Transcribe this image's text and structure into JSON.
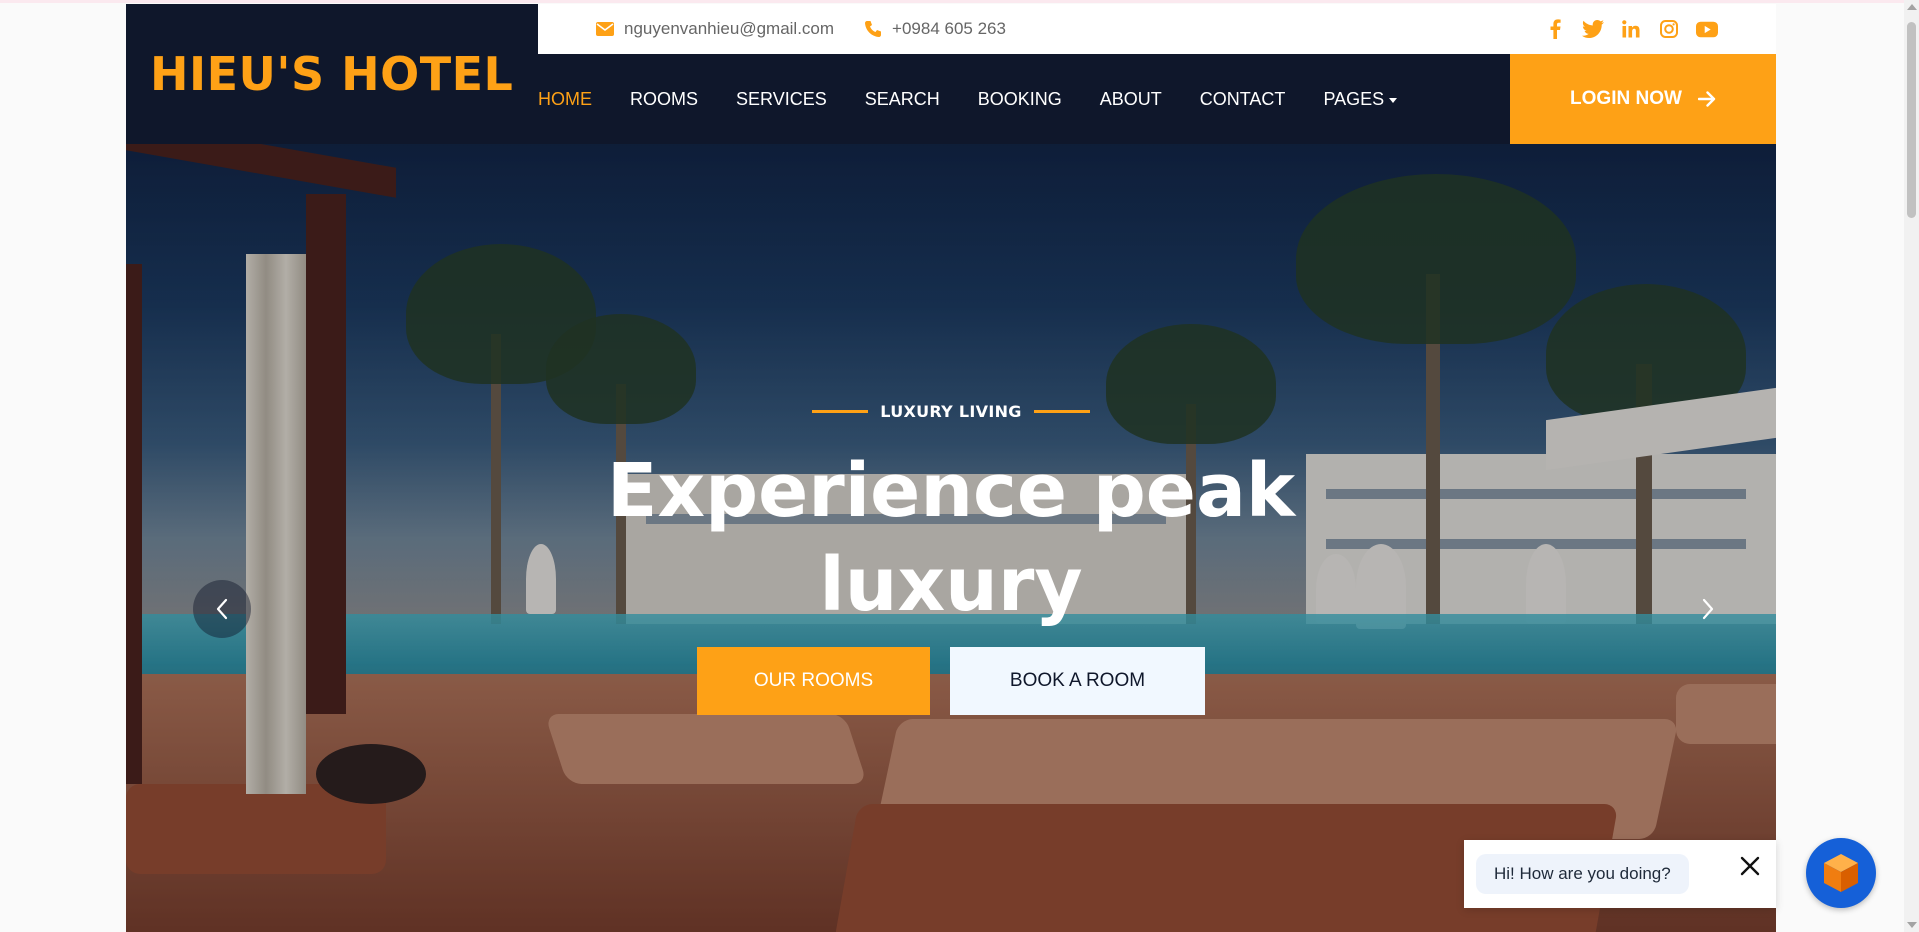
{
  "brand": {
    "name": "HIEU'S HOTEL"
  },
  "contact": {
    "email": "nguyenvanhieu@gmail.com",
    "phone": "+0984 605 263",
    "email_icon": "envelope-icon",
    "phone_icon": "phone-icon"
  },
  "socials": [
    "facebook-icon",
    "twitter-icon",
    "linkedin-icon",
    "instagram-icon",
    "youtube-icon"
  ],
  "nav": {
    "items": [
      {
        "label": "HOME",
        "active": true
      },
      {
        "label": "ROOMS"
      },
      {
        "label": "SERVICES"
      },
      {
        "label": "SEARCH"
      },
      {
        "label": "BOOKING"
      },
      {
        "label": "ABOUT"
      },
      {
        "label": "CONTACT"
      },
      {
        "label": "PAGES",
        "dropdown": true
      }
    ],
    "login_label": "LOGIN NOW"
  },
  "hero": {
    "eyebrow": "LUXURY LIVING",
    "headline_line1": "Experience peak",
    "headline_line2": "luxury",
    "cta_primary": "OUR ROOMS",
    "cta_secondary": "BOOK A ROOM"
  },
  "chat": {
    "message": "Hi! How are you doing?"
  },
  "colors": {
    "accent": "#fea116",
    "dark": "#0f172b",
    "light_button": "#f1f8ff",
    "chat_launcher": "#1560d8"
  }
}
